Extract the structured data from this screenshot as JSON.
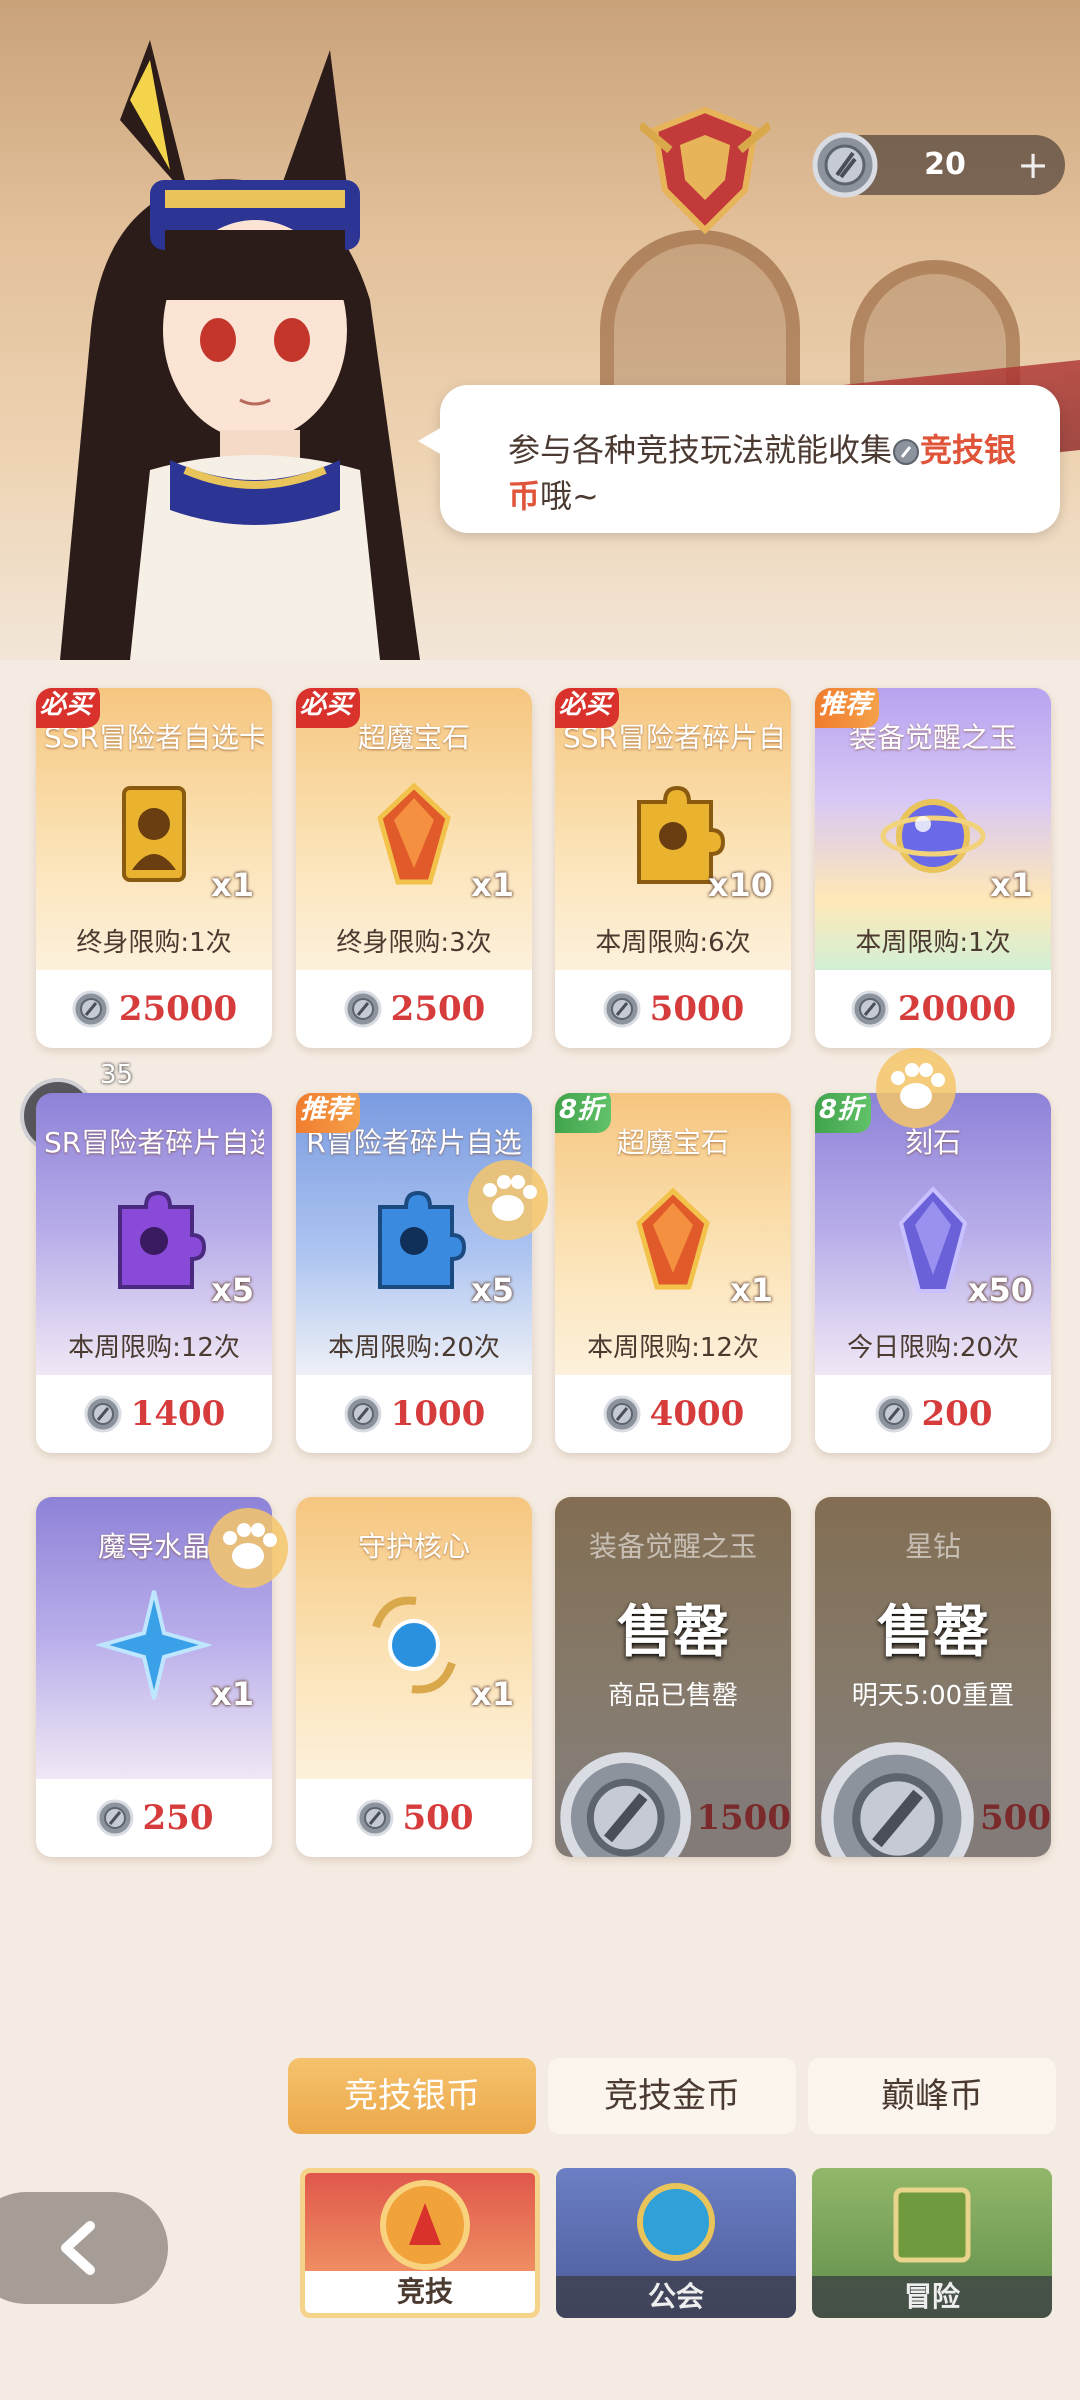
{
  "currency": {
    "count": "20",
    "plus": "+",
    "icon": "silver-coin-icon"
  },
  "npc": {
    "text_before": "参与各种竞技玩法就能收集",
    "highlight": "竞技银币",
    "text_after": "哦~"
  },
  "chat": {
    "badge": "35"
  },
  "cards": [
    {
      "tag": "必买",
      "tag_color": "#d9322d",
      "name": "SSR冒险者自选卡",
      "qty": "x1",
      "limit": "终身限购:1次",
      "price": "25000",
      "item_icon": "ssr-card-icon"
    },
    {
      "tag": "必买",
      "tag_color": "#d9322d",
      "name": "超魔宝石",
      "qty": "x1",
      "limit": "终身限购:3次",
      "price": "2500",
      "item_icon": "red-gem-icon"
    },
    {
      "tag": "必买",
      "tag_color": "#d9322d",
      "name": "SSR冒险者碎片自选",
      "qty": "x10",
      "limit": "本周限购:6次",
      "price": "5000",
      "item_icon": "gold-puzzle-icon"
    },
    {
      "tag": "推荐",
      "tag_color": "#f07a2c",
      "name": "装备觉醒之玉",
      "qty": "x1",
      "limit": "本周限购:1次",
      "price": "20000",
      "item_icon": "awakening-orb-icon"
    },
    {
      "tag": "",
      "name": "SR冒险者碎片自选",
      "qty": "x5",
      "limit": "本周限购:12次",
      "price": "1400",
      "item_icon": "purple-puzzle-icon"
    },
    {
      "tag": "推荐",
      "tag_color": "#f07a2c",
      "name": "R冒险者碎片自选",
      "qty": "x5",
      "limit": "本周限购:20次",
      "price": "1000",
      "item_icon": "blue-puzzle-icon"
    },
    {
      "tag": "8折",
      "tag_color": "#3ea14a",
      "name": "超魔宝石",
      "qty": "x1",
      "limit": "本周限购:12次",
      "price": "4000",
      "item_icon": "red-gem-icon"
    },
    {
      "tag": "8折",
      "tag_color": "#3ea14a",
      "name": "刻石",
      "qty": "x50",
      "limit": "今日限购:20次",
      "price": "200",
      "item_icon": "crystal-icon"
    },
    {
      "tag": "",
      "name": "魔导水晶",
      "qty": "x1",
      "limit": "",
      "price": "250",
      "item_icon": "blue-star-crystal-icon"
    },
    {
      "tag": "",
      "name": "守护核心",
      "qty": "x1",
      "limit": "",
      "price": "500",
      "item_icon": "guard-core-icon"
    }
  ],
  "soldout_cards": [
    {
      "name": "装备觉醒之玉",
      "label": "售罄",
      "note": "商品已售罄",
      "price": "1500"
    },
    {
      "name": "星钻",
      "label": "售罄",
      "note": "明天5:00重置",
      "price": "500"
    }
  ],
  "currency_tabs": [
    "竞技银币",
    "竞技金币",
    "巅峰币"
  ],
  "shop_tabs": [
    "竞技",
    "公会",
    "冒险"
  ],
  "colors": {
    "accent": "#eba94b",
    "price": "#d63c3c",
    "highlight": "#e0553a"
  }
}
